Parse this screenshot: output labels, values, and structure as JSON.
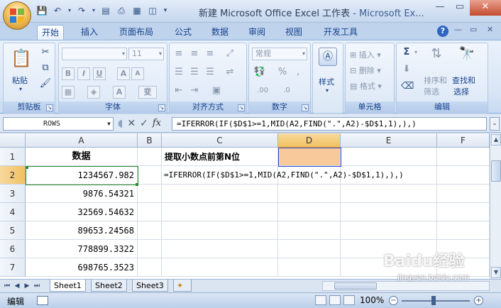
{
  "window": {
    "title": "新建 Microsoft Office Excel 工作表",
    "app": " - Microsoft Ex...",
    "minimize": "—",
    "maximize": "▭",
    "close": "✕"
  },
  "qat": {
    "save_icon": "save-icon",
    "undo_icon": "undo-icon",
    "redo_icon": "redo-icon"
  },
  "tabs": [
    {
      "label": "开始"
    },
    {
      "label": "插入"
    },
    {
      "label": "页面布局"
    },
    {
      "label": "公式"
    },
    {
      "label": "数据"
    },
    {
      "label": "审阅"
    },
    {
      "label": "视图"
    },
    {
      "label": "开发工具"
    }
  ],
  "tab_help": "?",
  "ribbon": {
    "clipboard": {
      "paste": "粘贴",
      "label": "剪贴板"
    },
    "font": {
      "size": "11",
      "bold": "B",
      "italic": "I",
      "underline": "U",
      "grow": "A",
      "shrink": "A",
      "color": "A",
      "phonetic": "变",
      "label": "字体"
    },
    "alignment": {
      "label": "对齐方式"
    },
    "number": {
      "format": "常规",
      "percent": "%",
      "comma": ",",
      "label": "数字"
    },
    "styles": {
      "label": "样式"
    },
    "cells": {
      "insert": "插入",
      "delete": "删除",
      "format": "格式",
      "label": "单元格"
    },
    "editing": {
      "sum": "Σ",
      "sort": "排序和",
      "sort2": "筛选",
      "find": "查找和",
      "find2": "选择",
      "label": "编辑"
    }
  },
  "formula_bar": {
    "name_box": "ROWS",
    "cancel": "✕",
    "enter": "✓",
    "fx": "fx",
    "formula": "=IFERROR(IF($D$1>=1,MID(A2,FIND(\".\",A2)-$D$1,1),),)",
    "expand": "⌄"
  },
  "columns": [
    "A",
    "B",
    "C",
    "D",
    "E",
    "F"
  ],
  "rows": [
    "1",
    "2",
    "3",
    "4",
    "5",
    "6",
    "7"
  ],
  "cells": {
    "A1": "数据",
    "C1": "提取小数点前第N位",
    "A2": "1234567.982",
    "A3": "9876.54321",
    "A4": "32569.54632",
    "A5": "89653.24568",
    "A6": "778899.3322",
    "A7": "698765.3523",
    "C2": "=IFERROR(IF($D$1>=1,MID(A2,FIND(\".\",A2)-$D$1,1),),)"
  },
  "colors": {
    "d1_fill": "#f8c99a",
    "selection": "#222222",
    "ref_green": "#2a8a2a",
    "ref_blue": "#2750c9"
  },
  "sheets": [
    {
      "label": "Sheet1"
    },
    {
      "label": "Sheet2"
    },
    {
      "label": "Sheet3"
    }
  ],
  "status": {
    "mode": "编辑",
    "zoom": "100%",
    "zoom_minus": "−",
    "zoom_plus": "+"
  },
  "watermark": {
    "text": "Baidu经验",
    "sub": "jingyan.baidu.com"
  }
}
